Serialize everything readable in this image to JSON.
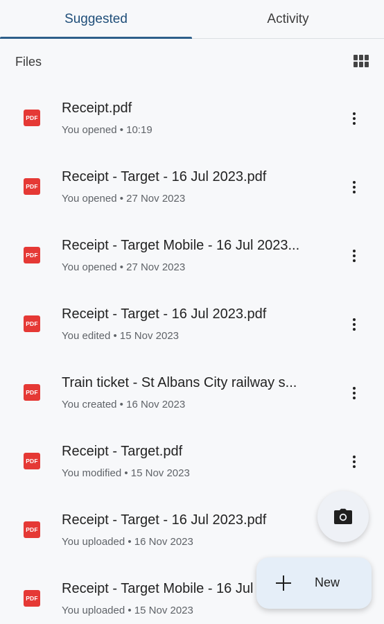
{
  "tabs": [
    {
      "label": "Suggested",
      "active": true
    },
    {
      "label": "Activity",
      "active": false
    }
  ],
  "section": {
    "title": "Files",
    "view_icon": "grid-view-icon"
  },
  "files": [
    {
      "icon": "pdf-icon",
      "icon_label": "PDF",
      "name": "Receipt.pdf",
      "meta": "You opened • 10:19"
    },
    {
      "icon": "pdf-icon",
      "icon_label": "PDF",
      "name": "Receipt - Target - 16 Jul 2023.pdf",
      "meta": "You opened • 27 Nov 2023"
    },
    {
      "icon": "pdf-icon",
      "icon_label": "PDF",
      "name": "Receipt - Target Mobile - 16 Jul 2023...",
      "meta": "You opened • 27 Nov 2023"
    },
    {
      "icon": "pdf-icon",
      "icon_label": "PDF",
      "name": "Receipt - Target - 16 Jul 2023.pdf",
      "meta": "You edited • 15 Nov 2023"
    },
    {
      "icon": "pdf-icon",
      "icon_label": "PDF",
      "name": "Train ticket - St Albans City railway s...",
      "meta": "You created • 16 Nov 2023"
    },
    {
      "icon": "pdf-icon",
      "icon_label": "PDF",
      "name": "Receipt - Target.pdf",
      "meta": "You modified • 15 Nov 2023"
    },
    {
      "icon": "pdf-icon",
      "icon_label": "PDF",
      "name": "Receipt - Target - 16 Jul 2023.pdf",
      "meta": "You uploaded • 16 Nov 2023"
    },
    {
      "icon": "pdf-icon",
      "icon_label": "PDF",
      "name": "Receipt - Target Mobile - 16 Jul 2023.pdf",
      "meta": "You uploaded • 15 Nov 2023"
    }
  ],
  "fab": {
    "camera_icon": "camera-icon",
    "new_label": "New",
    "new_icon": "plus-icon"
  },
  "colors": {
    "accent": "#2d5f8a",
    "pdf": "#e53935",
    "background": "#f7f8fa"
  }
}
